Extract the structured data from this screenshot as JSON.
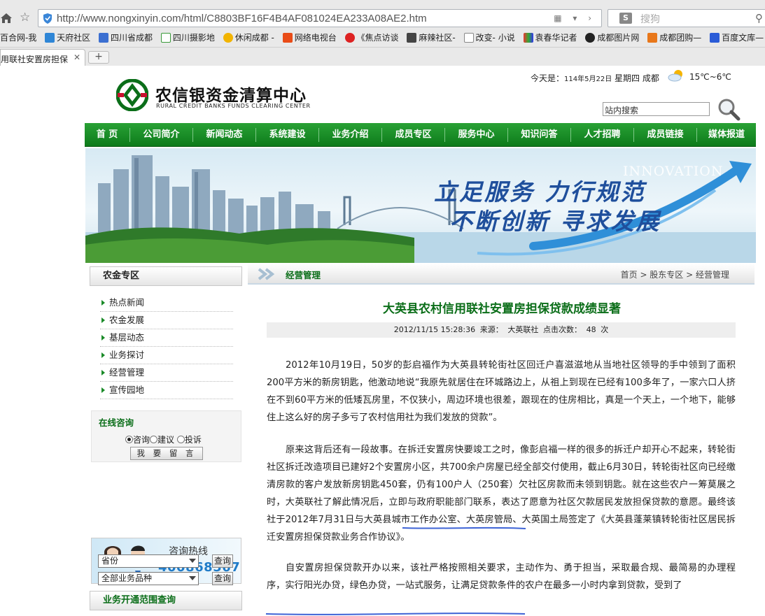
{
  "browser": {
    "url": "http://www.nongxinyin.com/html/C8803BF16F4B4AF081024EA233A08AE2.htm",
    "search_placeholder": "搜狗",
    "bookmarks": [
      "百合网-我",
      "天府社区",
      "四川省成都",
      "四川摄影地",
      "休闲成都 -",
      "网络电视台",
      "《焦点访谈",
      "麻辣社区-",
      "改变- 小说",
      "袁春华记者",
      "成都图片网",
      "成都团购—",
      "百度文库—"
    ],
    "tab_title": "用联社安置房担保"
  },
  "header": {
    "logo_cn": "农信银资金清算中心",
    "logo_en": "RURAL CREDIT BANKS FUNDS CLEARING CENTER",
    "today_label": "今天是：",
    "today_date": "114年5月22日",
    "weekday": "星期四",
    "city": "成都",
    "temp": "15℃~6℃",
    "search_placeholder": "站内搜索"
  },
  "nav": [
    "首 页",
    "公司简介",
    "新闻动态",
    "系统建设",
    "业务介绍",
    "成员专区",
    "服务中心",
    "知识问答",
    "人才招聘",
    "成员链接",
    "媒体报道"
  ],
  "banner": {
    "slogan_line1": "立足服务 力行规范",
    "slogan_line2": "不断创新 寻求发展",
    "innovation": "INNOVATION"
  },
  "sidebar": {
    "section_title": "农金专区",
    "menu": [
      "热点新闻",
      "农金发展",
      "基层动态",
      "业务探讨",
      "经营管理",
      "宣传园地"
    ],
    "consult_title": "在线咨询",
    "consult_options": [
      "咨询",
      "建议",
      "投诉"
    ],
    "message_button": "我 要 留 言",
    "hotline_label": "咨询热线",
    "hotline_number": "4008685678",
    "business_title": "业务开通范围查询",
    "select_province": "省份",
    "select_business": "全部业务品种",
    "query_label": "查询"
  },
  "article": {
    "section": "经营管理",
    "breadcrumb": "首页 > 股东专区 > 经营管理",
    "title": "大英县农村信用联社安置房担保贷款成绩显著",
    "datetime": "2012/11/15 15:28:36",
    "source_label": "来源：",
    "source": "大英联社",
    "hits_label": "点击次数：",
    "hits": "48",
    "hits_unit": "次",
    "p1": "2012年10月19日，50岁的彭启福作为大英县转轮街社区回迁户喜滋滋地从当地社区领导的手中领到了面积200平方米的新房钥匙，他激动地说“我原先就居住在环城路边上，从祖上到现在已经有100多年了，一家六口人挤在不到60平方米的低矮瓦房里，不仅狭小，周边环境也很差，跟现在的住房相比，真是一个天上，一个地下，能够住上这么好的房子多亏了农村信用社为我们发放的贷款”。",
    "p2": "原来这背后还有一段故事。在拆迁安置房快要竣工之时，像彭启福一样的很多的拆迁户却开心不起来，转轮街社区拆迁改造项目已建好2个安置房小区，共700余户房屋已经全部交付使用，截止6月30日，转轮街社区向已经缴清房款的客户发放新房钥匙450套，仍有100户人（250套）欠社区房款而未领到钥匙。就在这些农户一筹莫展之时，大英联社了解此情况后，立即与政府职能部门联系，表达了愿意为社区欠款居民发放担保贷款的意愿。最终该社于2012年7月31日与大英县城市工作办公室、大英房管局、大英国土局签定了《大英县蓬莱镇转轮街社区居民拆迁安置房担保贷款业务合作协议》。",
    "p3": "自安置房担保贷款开办以来，该社严格按照相关要求，主动作为、勇于担当，采取最合规、最简易的办理程序，实行阳光办贷，绿色办贷，一站式服务，让满足贷款条件的农户在最多一小时内拿到贷款，受到了"
  },
  "colors": {
    "nav_green": "#0d7b1b",
    "title_green": "#0b6e19",
    "underline_blue": "#3d63d6"
  }
}
